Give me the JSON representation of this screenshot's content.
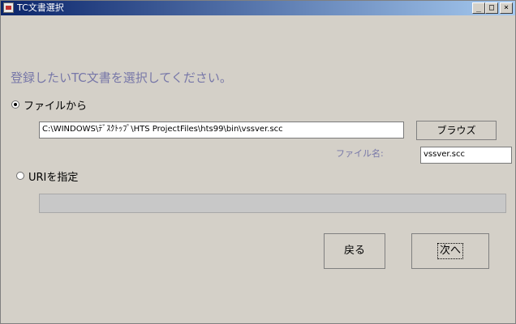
{
  "window": {
    "title": "TC文書選択",
    "controls": {
      "minimize": "_",
      "maximize": "□",
      "close": "×"
    }
  },
  "instruction": "登録したいTC文書を選択してください。",
  "file_option": {
    "label": "ファイルから",
    "selected": true,
    "path_value": "C:\\WINDOWS\\ﾃﾞｽｸﾄｯﾌﾟ\\HTS ProjectFiles\\hts99\\bin\\vssver.scc",
    "browse_label": "ブラウズ",
    "filename_label": "ファイル名:",
    "filename_value": "vssver.scc"
  },
  "uri_option": {
    "label": "URIを指定",
    "selected": false,
    "value": ""
  },
  "buttons": {
    "back": "戻る",
    "next": "次へ"
  },
  "colors": {
    "background": "#d4d0c8",
    "accent_text": "#7777a8",
    "titlebar_start": "#0a246a",
    "titlebar_end": "#a6caf0"
  }
}
